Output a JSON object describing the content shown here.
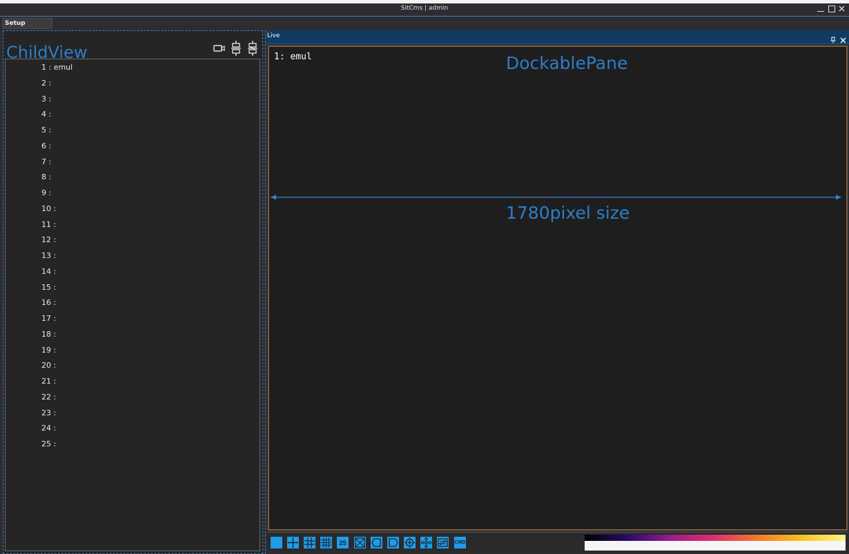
{
  "window": {
    "title": "SitCms | admin"
  },
  "menu": {
    "setup_tab": "Setup"
  },
  "child_view": {
    "title": "ChildView",
    "tool_icons": [
      "camera-icon",
      "connect-plug-icon",
      "disconnect-plug-icon"
    ],
    "items": [
      "1 : emul",
      "2 :",
      "3 :",
      "4 :",
      "5 :",
      "6 :",
      "7 :",
      "8 :",
      "9 :",
      "10 :",
      "11 :",
      "12 :",
      "13 :",
      "14 :",
      "15 :",
      "16 :",
      "17 :",
      "18 :",
      "19 :",
      "20 :",
      "21 :",
      "22 :",
      "23 :",
      "24 :",
      "25 :"
    ]
  },
  "live_pane": {
    "header": "Live",
    "camera_label": "1: emul",
    "annotation_title": "DockablePane",
    "annotation_size": "1780pixel size"
  },
  "toolbar": {
    "buttons": [
      {
        "icon": "layout-1x1-icon",
        "text": ""
      },
      {
        "icon": "layout-2x2-icon",
        "text": ""
      },
      {
        "icon": "layout-3x3-icon",
        "text": ""
      },
      {
        "icon": "layout-4x4-icon",
        "text": ""
      },
      {
        "icon": "layout-25-icon",
        "text": "25"
      },
      {
        "icon": "close-all-icon",
        "text": ""
      },
      {
        "icon": "previous-page-icon",
        "text": ""
      },
      {
        "icon": "next-page-icon",
        "text": ""
      },
      {
        "icon": "zoom-in-icon",
        "text": ""
      },
      {
        "icon": "ptz-direction-icon",
        "text": ""
      },
      {
        "icon": "swap-icon",
        "text": ""
      },
      {
        "icon": "cmd-icon",
        "text": "CMD"
      }
    ],
    "palette_colors": [
      "#000000",
      "#2a0a6e",
      "#9c1c8c",
      "#e0306a",
      "#f47a2a",
      "#f8c21e",
      "#fff38a"
    ]
  },
  "colors": {
    "accent": "#2f7dc8",
    "header_bg": "#0f3b63",
    "button_blue": "#1e9cec",
    "video_border": "#7a5c3e"
  }
}
